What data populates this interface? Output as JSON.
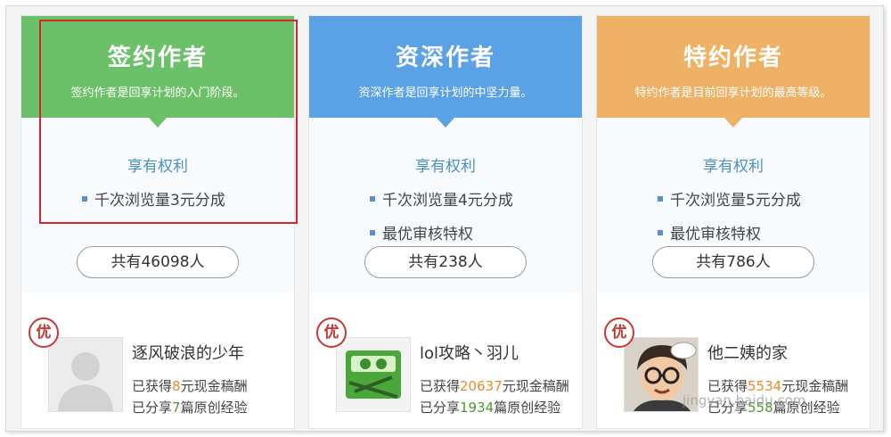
{
  "colors": {
    "green": "#6cc06a",
    "blue": "#5ba1e6",
    "orange": "#eeb166",
    "highlight": "#d6262c",
    "badge": "#c53a34"
  },
  "tiers": [
    {
      "title": "签约作者",
      "desc": "签约作者是回享计划的入门阶段。",
      "rights_title": "享有权利",
      "benefits": [
        "千次浏览量3元分成"
      ],
      "count": "共有46098人",
      "user": {
        "badge": "优",
        "avatar": "default-avatar",
        "name": "逐风破浪的少年",
        "earn_pre": "已获得",
        "earn_num": "8",
        "earn_post": "元现金稿酬",
        "share_pre": "已分享",
        "share_num": "7",
        "share_post": "篇原创经验"
      }
    },
    {
      "title": "资深作者",
      "desc": "资深作者是回享计划的中坚力量。",
      "rights_title": "享有权利",
      "benefits": [
        "千次浏览量4元分成",
        "最优审核特权"
      ],
      "count": "共有238人",
      "user": {
        "badge": "优",
        "avatar": "game-avatar",
        "name": "lol攻略丶羽儿",
        "earn_pre": "已获得",
        "earn_num": "20637",
        "earn_post": "元现金稿酬",
        "share_pre": "已分享",
        "share_num": "1934",
        "share_post": "篇原创经验"
      }
    },
    {
      "title": "特约作者",
      "desc": "特约作者是目前回享计划的最高等级。",
      "rights_title": "享有权利",
      "benefits": [
        "千次浏览量5元分成",
        "最优审核特权"
      ],
      "count": "共有786人",
      "user": {
        "badge": "优",
        "avatar": "cartoon-avatar",
        "name": "他二姨的家",
        "earn_pre": "已获得",
        "earn_num": "5534",
        "earn_post": "元现金稿酬",
        "share_pre": "已分享",
        "share_num": "558",
        "share_post": "篇原创经验"
      }
    }
  ],
  "watermark": "jingyan.baidu.com"
}
